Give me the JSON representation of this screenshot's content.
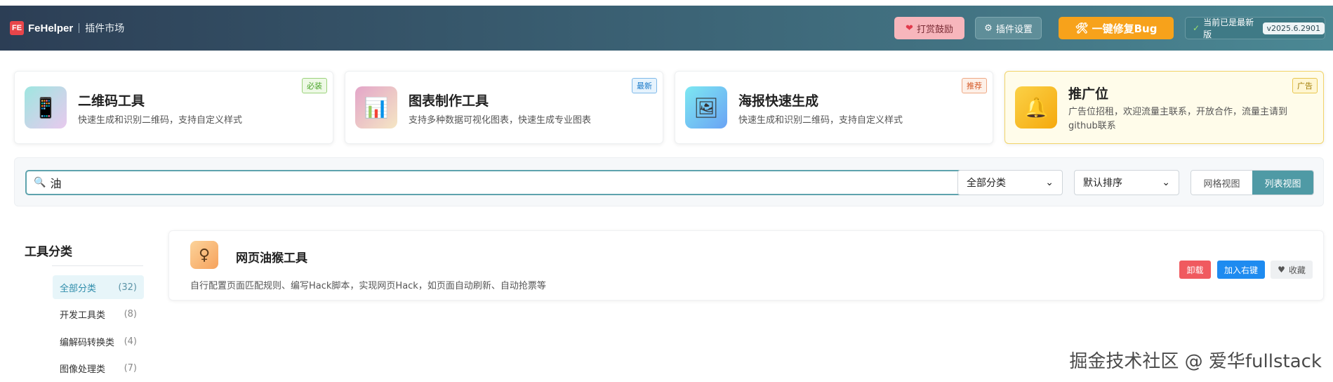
{
  "header": {
    "logo_mark": "FE",
    "app_name": "FeHelper",
    "section": "插件市场",
    "donate_label": "打赏鼓励",
    "settings_label": "插件设置",
    "fix_label": "一键修复Bug",
    "status_label": "当前已是最新版",
    "version": "v2025.6.2901"
  },
  "promos": [
    {
      "title": "二维码工具",
      "desc": "快速生成和识别二维码，支持自定义样式",
      "badge": "必装",
      "icon": "phone-icon"
    },
    {
      "title": "图表制作工具",
      "desc": "支持多种数据可视化图表，快速生成专业图表",
      "badge": "最新",
      "icon": "bar-chart-icon"
    },
    {
      "title": "海报快速生成",
      "desc": "快速生成和识别二维码，支持自定义样式",
      "badge": "推荐",
      "icon": "picture-icon"
    },
    {
      "title": "推广位",
      "desc": "广告位招租，欢迎流量主联系，开放合作，流量主请到github联系",
      "badge": "广告",
      "icon": "bell-icon"
    }
  ],
  "search": {
    "value": "油",
    "category_selected": "全部分类",
    "sort_selected": "默认排序",
    "view_grid": "网格视图",
    "view_list": "列表视图"
  },
  "sidebar": {
    "title": "工具分类",
    "items": [
      {
        "label": "全部分类",
        "count": "(32)",
        "active": true
      },
      {
        "label": "开发工具类",
        "count": "(8)"
      },
      {
        "label": "编解码转换类",
        "count": "(4)"
      },
      {
        "label": "图像处理类",
        "count": "(7)"
      }
    ]
  },
  "tools": [
    {
      "name": "网页油猴工具",
      "desc": "自行配置页面匹配规则、编写Hack脚本，实现网页Hack，如页面自动刷新、自动抢票等",
      "uninstall": "卸载",
      "add_menu": "加入右键",
      "favorite": "收藏"
    }
  ],
  "watermark": "掘金技术社区 @ 爱华fullstack",
  "colors": {
    "header_start": "#2c3e55",
    "header_end": "#4b8894",
    "accent": "#4f9aa5",
    "fix_button": "#f7a21b",
    "uninstall": "#f05a5f",
    "add_menu": "#1e8bf0"
  }
}
